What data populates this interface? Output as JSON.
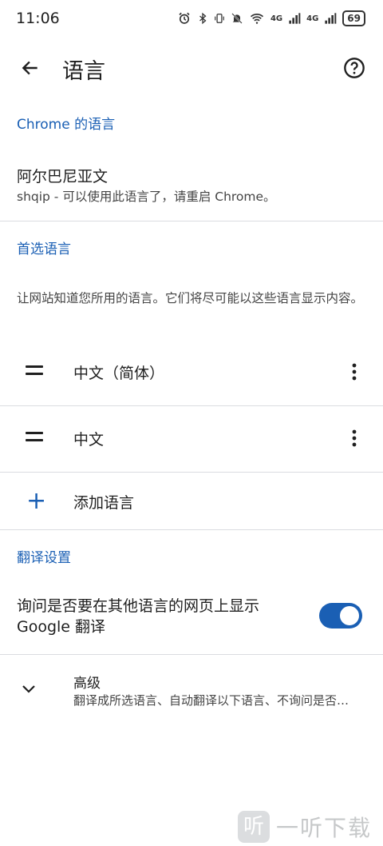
{
  "status_bar": {
    "time": "11:06",
    "battery": "69",
    "network_1": "4G",
    "network_2": "4G"
  },
  "top_bar": {
    "title": "语言"
  },
  "chrome_language": {
    "header": "Chrome 的语言",
    "title": "阿尔巴尼亚文",
    "subtitle": "shqip - 可以使用此语言了，请重启 Chrome。"
  },
  "preferred": {
    "header": "首选语言",
    "description": "让网站知道您所用的语言。它们将尽可能以这些语言显示内容。",
    "languages": [
      {
        "label": "中文（简体）"
      },
      {
        "label": "中文"
      }
    ],
    "add_label": "添加语言"
  },
  "translate": {
    "header": "翻译设置",
    "offer_label": "询问是否要在其他语言的网页上显示 Google 翻译",
    "enabled": true
  },
  "advanced": {
    "title": "高级",
    "subtitle": "翻译成所选语言、自动翻译以下语言、不询问是否翻译以下语言"
  },
  "watermark": {
    "logo_char": "听",
    "text": "一听下载"
  },
  "colors": {
    "accent": "#1a5fb4",
    "divider": "#dadce0"
  }
}
